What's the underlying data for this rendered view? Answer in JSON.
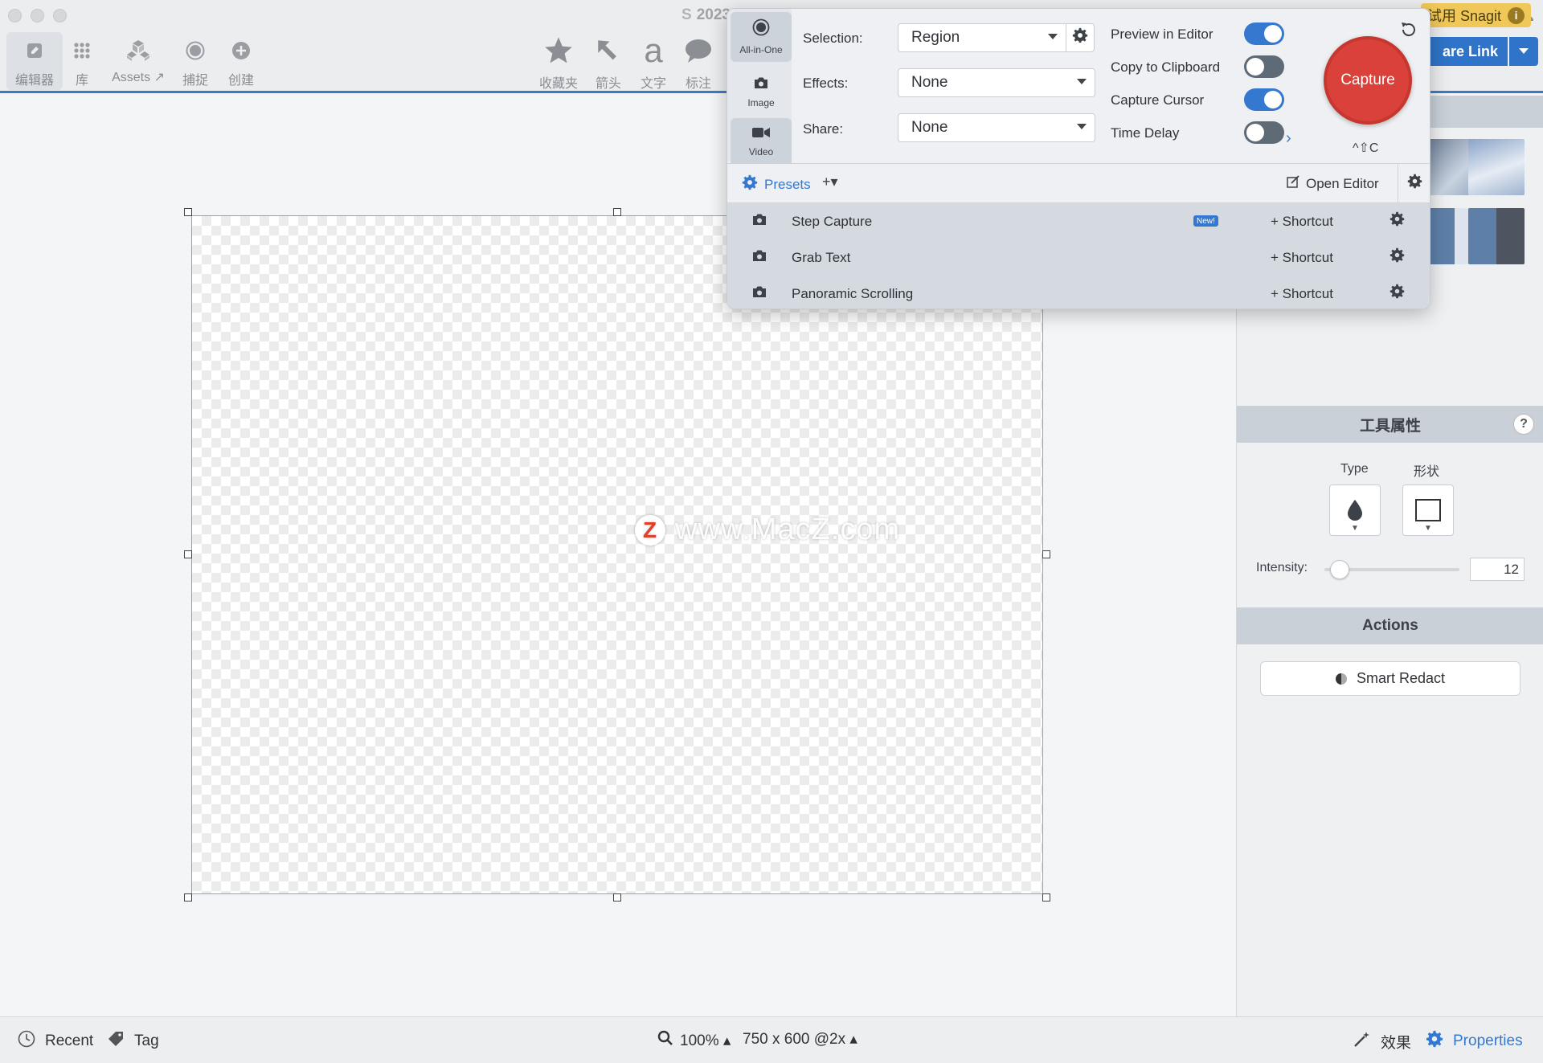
{
  "window": {
    "doc_title": "2023",
    "snagit_badge": "试用 Snagit",
    "share_link": "are Link"
  },
  "toolbar": {
    "left": [
      {
        "label": "编辑器",
        "icon": "edit-icon",
        "active": true
      },
      {
        "label": "库",
        "icon": "grid-icon"
      },
      {
        "label": "Assets ↗",
        "icon": "cubes-icon"
      },
      {
        "label": "捕捉",
        "icon": "record-icon"
      },
      {
        "label": "创建",
        "icon": "plus-circle-icon"
      }
    ],
    "tools": [
      {
        "label": "收藏夹",
        "icon": "star-icon"
      },
      {
        "label": "箭头",
        "icon": "arrow-icon"
      },
      {
        "label": "文字",
        "icon": "text-icon"
      },
      {
        "label": "标注",
        "icon": "callout-icon"
      }
    ]
  },
  "watermark": {
    "text": "www.MacZ.com",
    "logo": "Z"
  },
  "capture_panel": {
    "tabs": [
      {
        "label": "All-in-One",
        "icon": "record-icon",
        "active": true
      },
      {
        "label": "Image",
        "icon": "camera-icon",
        "active": false
      },
      {
        "label": "Video",
        "icon": "video-icon",
        "active": false
      }
    ],
    "selection_label": "Selection:",
    "selection_value": "Region",
    "effects_label": "Effects:",
    "effects_value": "None",
    "share_label": "Share:",
    "share_value": "None",
    "options": [
      {
        "label": "Preview in Editor",
        "on": true
      },
      {
        "label": "Copy to Clipboard",
        "on": false
      },
      {
        "label": "Capture Cursor",
        "on": true
      },
      {
        "label": "Time Delay",
        "on": false
      }
    ],
    "capture_label": "Capture",
    "capture_shortcut": "^⇧C",
    "presets_label": "Presets",
    "presets_add": "+▾",
    "open_editor": "Open Editor",
    "presets": [
      {
        "name": "Step Capture",
        "badge": "New!",
        "shortcut": "+ Shortcut"
      },
      {
        "name": "Grab Text",
        "badge": "",
        "shortcut": "+ Shortcut"
      },
      {
        "name": "Panoramic Scrolling",
        "badge": "",
        "shortcut": "+ Shortcut"
      }
    ]
  },
  "sidebar": {
    "tool_props_title": "工具属性",
    "help": "?",
    "type_label": "Type",
    "shape_label": "形状",
    "intensity_label": "Intensity:",
    "intensity_value": "12",
    "intensity_fraction": 0.05,
    "actions_title": "Actions",
    "smart_redact": "Smart Redact"
  },
  "statusbar": {
    "recent": "Recent",
    "tag": "Tag",
    "zoom": "100% ▴",
    "dimensions": "750 x 600 @2x ▴",
    "effects": "效果",
    "properties": "Properties"
  },
  "colors": {
    "accent": "#3578d0",
    "capture": "#d9413a",
    "badge": "#f0c85a"
  }
}
